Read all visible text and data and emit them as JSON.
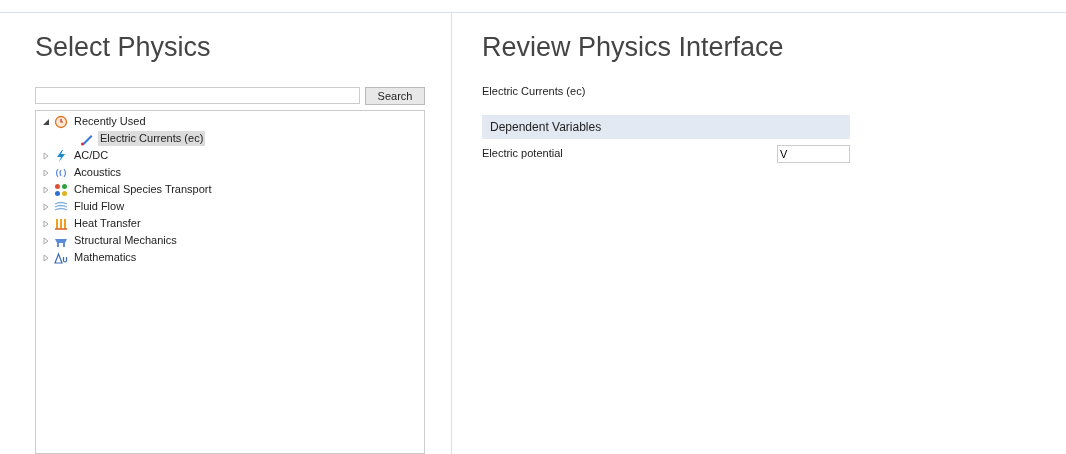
{
  "select_physics": {
    "title": "Select Physics",
    "search": {
      "button": "Search"
    },
    "tree": [
      {
        "label": "Recently Used",
        "kind": "clock",
        "expanded": true,
        "children": [
          {
            "label": "Electric Currents (ec)",
            "kind": "current",
            "selected": true
          }
        ]
      },
      {
        "label": "AC/DC",
        "kind": "bolt",
        "expanded": false
      },
      {
        "label": "Acoustics",
        "kind": "sound",
        "expanded": false
      },
      {
        "label": "Chemical Species Transport",
        "kind": "chem",
        "expanded": false
      },
      {
        "label": "Fluid Flow",
        "kind": "flow",
        "expanded": false
      },
      {
        "label": "Heat Transfer",
        "kind": "heat",
        "expanded": false
      },
      {
        "label": "Structural Mechanics",
        "kind": "struct",
        "expanded": false
      },
      {
        "label": "Mathematics",
        "kind": "math",
        "expanded": false
      }
    ]
  },
  "review": {
    "title": "Review Physics Interface",
    "interface": "Electric Currents (ec)",
    "section": "Dependent Variables",
    "fields": [
      {
        "label": "Electric potential",
        "value": "V"
      }
    ]
  }
}
